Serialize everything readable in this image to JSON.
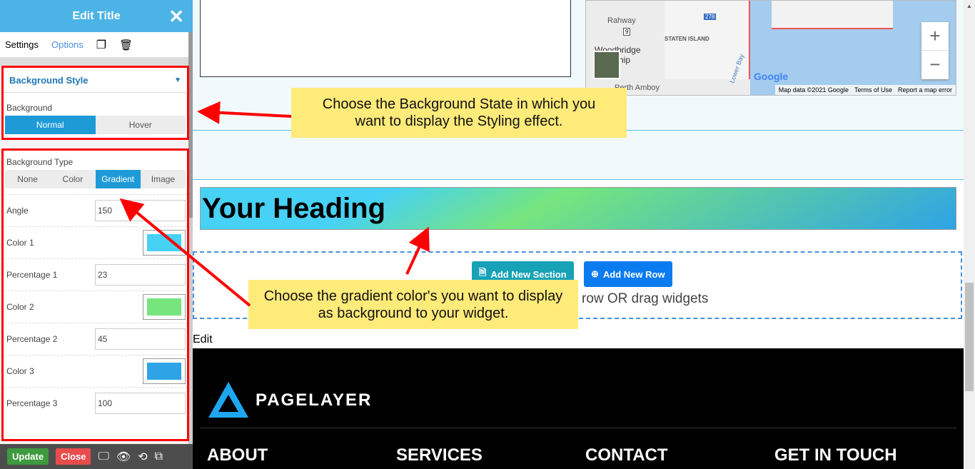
{
  "sidebar": {
    "title": "Edit Title",
    "tabs": [
      "Settings",
      "Options"
    ],
    "bg_style": {
      "title": "Background Style",
      "label": "Background",
      "states": [
        "Normal",
        "Hover"
      ],
      "active": "Normal"
    },
    "bg_type": {
      "label": "Background Type",
      "options": [
        "None",
        "Color",
        "Gradient",
        "Image"
      ],
      "active": "Gradient"
    },
    "fields": {
      "angle_label": "Angle",
      "angle": "150",
      "c1_label": "Color 1",
      "c1": "#47d1f5",
      "p1_label": "Percentage 1",
      "p1": "23",
      "c2_label": "Color 2",
      "c2": "#76e57e",
      "p2_label": "Percentage 2",
      "p2": "45",
      "c3_label": "Color 3",
      "c3": "#2ea3e6",
      "p3_label": "Percentage 3",
      "p3": "100"
    },
    "footer": {
      "update": "Update",
      "close": "Close"
    }
  },
  "map": {
    "places": [
      "Rahway",
      "Woodbridge Township",
      "STATEN ISLAND",
      "Perth Amboy",
      "Lower Bay"
    ],
    "shields": [
      "9",
      "278"
    ],
    "attribution": [
      "Map data ©2021 Google",
      "Terms of Use",
      "Report a map error"
    ],
    "logo": "Google"
  },
  "main": {
    "heading": "Your Heading",
    "add_section": "Add New Section",
    "add_row": "Add New Row",
    "hint": "row OR drag widgets",
    "edit": "Edit"
  },
  "site_footer": {
    "brand": "PAGELAYER",
    "headings": [
      "ABOUT",
      "SERVICES",
      "CONTACT",
      "GET IN TOUCH"
    ]
  },
  "callouts": [
    "Choose the Background State in which you want to display the Styling effect.",
    "Choose the gradient color's you want to display as background to your widget."
  ]
}
